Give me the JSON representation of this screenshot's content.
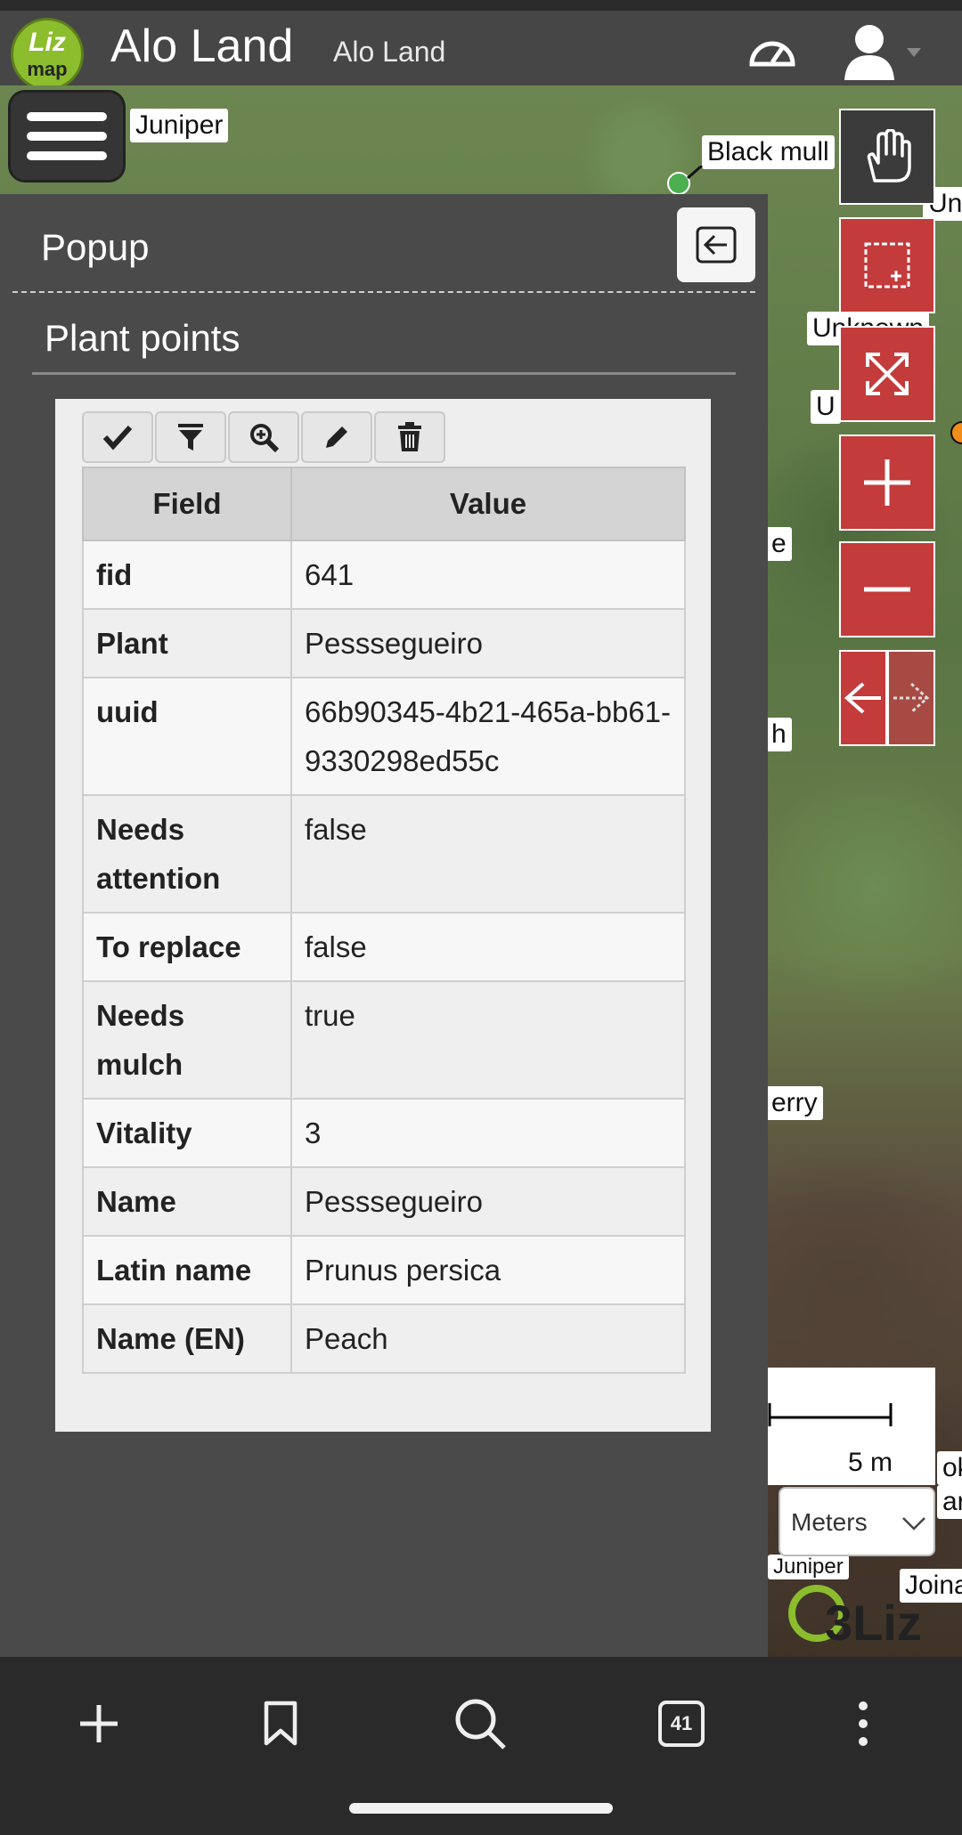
{
  "header": {
    "logo_line1": "Liz",
    "logo_line2": "map",
    "title": "Alo Land",
    "subtitle": "Alo Land"
  },
  "map": {
    "labels": {
      "juniper": "Juniper",
      "black_mulch": "Black mull",
      "unknown_1": "Unknown",
      "unknown_2": "Unkn",
      "unknown_3": "U",
      "l1": "e",
      "l2": "h",
      "l3": "erry",
      "l4": "Juniper",
      "l5": "Joina",
      "l6": "ok",
      "l7": "ar"
    },
    "scale": {
      "label": "5 m"
    },
    "units": {
      "selected": "Meters"
    },
    "brand": "3Liz"
  },
  "panel": {
    "title": "Popup",
    "layer": "Plant points"
  },
  "table": {
    "headers": [
      "Field",
      "Value"
    ],
    "rows": [
      {
        "field": "fid",
        "value": "641"
      },
      {
        "field": "Plant",
        "value": "Pesssegueiro"
      },
      {
        "field": "uuid",
        "value": "66b90345-4b21-465a-bb61-9330298ed55c"
      },
      {
        "field": "Needs attention",
        "value": "false"
      },
      {
        "field": "To replace",
        "value": "false"
      },
      {
        "field": "Needs mulch",
        "value": "true"
      },
      {
        "field": "Vitality",
        "value": "3"
      },
      {
        "field": "Name",
        "value": "Pesssegueiro"
      },
      {
        "field": "Latin name",
        "value": "Prunus persica"
      },
      {
        "field": "Name (EN)",
        "value": "Peach"
      }
    ]
  },
  "bottom_nav": {
    "tabs_count": "41"
  },
  "colors": {
    "accent": "#c33b3b",
    "lizmap_green": "#8cbd2d",
    "panel": "#4a4a4a"
  }
}
